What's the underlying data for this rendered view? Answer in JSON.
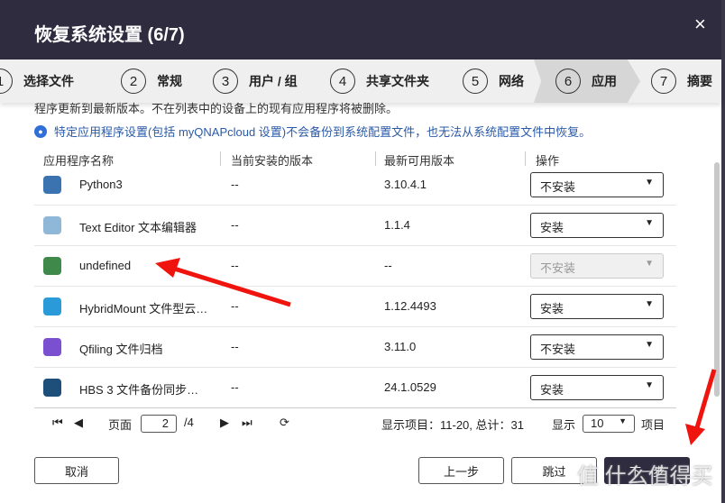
{
  "title": "恢复系统设置 (6/7)",
  "close": "×",
  "steps": [
    {
      "n": "1",
      "label": "选择文件"
    },
    {
      "n": "2",
      "label": "常规"
    },
    {
      "n": "3",
      "label": "用户 / 组"
    },
    {
      "n": "4",
      "label": "共享文件夹"
    },
    {
      "n": "5",
      "label": "网络"
    },
    {
      "n": "6",
      "label": "应用"
    },
    {
      "n": "7",
      "label": "摘要"
    }
  ],
  "notice": "程序更新到最新版本。不在列表中的设备上的现有应用程序将被删除。",
  "info": "特定应用程序设置(包括 myQNAPcloud 设置)不会备份到系统配置文件，也无法从系统配置文件中恢复。",
  "columns": [
    "应用程序名称",
    "当前安装的版本",
    "最新可用版本",
    "操作"
  ],
  "rows": [
    {
      "name": "Python3",
      "current": "--",
      "latest": "3.10.4.1",
      "action": "不安装",
      "color": "#3a73b0",
      "disabled": false
    },
    {
      "name": "Text Editor 文本编辑器",
      "current": "--",
      "latest": "1.1.4",
      "action": "安装",
      "color": "#8fb7d8",
      "disabled": false
    },
    {
      "name": "undefined",
      "current": "--",
      "latest": "--",
      "action": "不安装",
      "color": "#3f8a4a",
      "disabled": true
    },
    {
      "name": "HybridMount 文件型云…",
      "current": "--",
      "latest": "1.12.4493",
      "action": "安装",
      "color": "#2a9bd8",
      "disabled": false
    },
    {
      "name": "Qfiling 文件归档",
      "current": "--",
      "latest": "3.11.0",
      "action": "不安装",
      "color": "#7a4fd0",
      "disabled": false
    },
    {
      "name": "HBS 3 文件备份同步…",
      "current": "--",
      "latest": "24.1.0529",
      "action": "安装",
      "color": "#1e4f7a",
      "disabled": false
    }
  ],
  "pager": {
    "page_label": "页面",
    "page": "2",
    "of": "/4",
    "display_info": "显示项目：11-20, 总计：31",
    "show_label": "显示",
    "per_page": "10",
    "items_label": "项目"
  },
  "buttons": {
    "cancel": "取消",
    "prev": "上一步",
    "skip": "跳过",
    "next": "下一步"
  },
  "watermark": "值 什么值得买"
}
